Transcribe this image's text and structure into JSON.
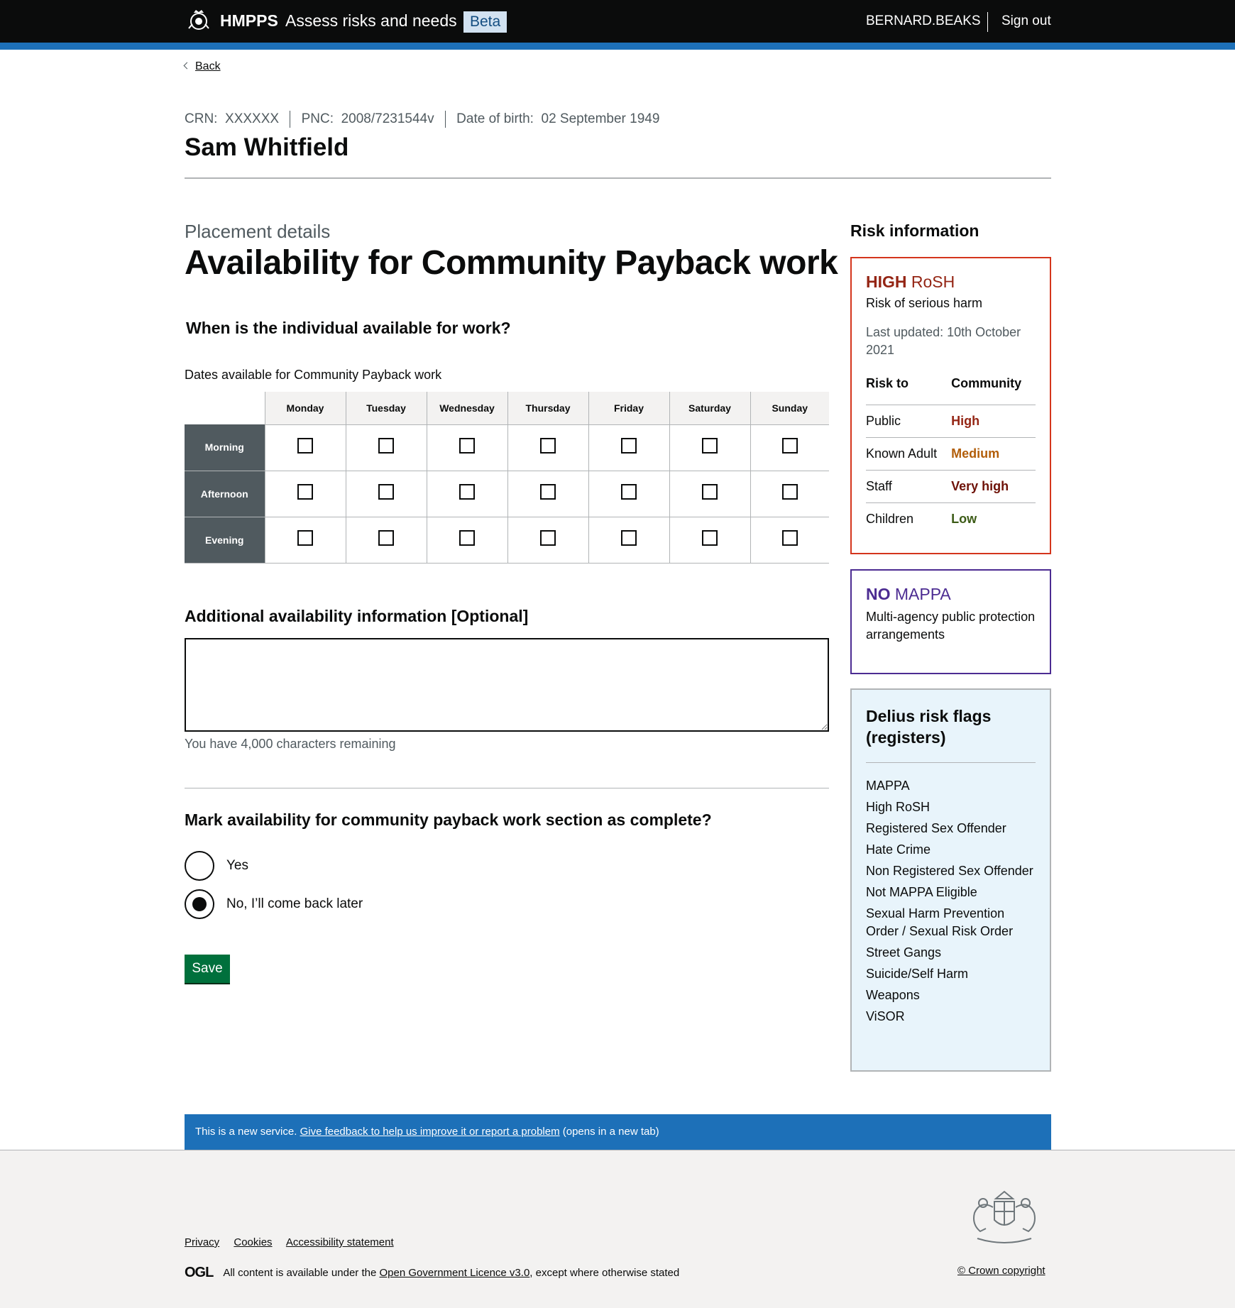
{
  "header": {
    "brand": "HMPPS",
    "service": "Assess risks and needs",
    "tag": "Beta",
    "username": "BERNARD.BEAKS",
    "signout": "Sign out"
  },
  "back": "Back",
  "person": {
    "crn_label": "CRN:",
    "crn": "XXXXXX",
    "pnc_label": "PNC:",
    "pnc": "2008/7231544v",
    "dob_label": "Date of birth:",
    "dob": "02 September 1949",
    "name": "Sam Whitfield"
  },
  "main": {
    "caption": "Placement details",
    "title": "Availability for Community Payback work",
    "question": "When is the individual available for work?",
    "table_caption": "Dates available for Community Payback work",
    "days": [
      "Monday",
      "Tuesday",
      "Wednesday",
      "Thursday",
      "Friday",
      "Saturday",
      "Sunday"
    ],
    "periods": [
      "Morning",
      "Afternoon",
      "Evening"
    ],
    "additional_label": "Additional availability information [Optional]",
    "additional_value": "",
    "char_count": "You have 4,000 characters remaining",
    "complete_question": "Mark availability for community payback work section as complete?",
    "radio_yes": "Yes",
    "radio_no": "No, I’ll come back later",
    "save": "Save"
  },
  "sidebar": {
    "heading": "Risk information",
    "rosh": {
      "level": "HIGH",
      "level_suffix": "RoSH",
      "subtitle": "Risk of serious harm",
      "updated": "Last updated: 10th October 2021",
      "col_risk_to": "Risk to",
      "col_community": "Community",
      "rows": [
        {
          "label": "Public",
          "value": "High",
          "color": "#942514"
        },
        {
          "label": "Known Adult",
          "value": "Medium",
          "color": "#b25e0a"
        },
        {
          "label": "Staff",
          "value": "Very high",
          "color": "#6e1208"
        },
        {
          "label": "Children",
          "value": "Low",
          "color": "#3c5b16"
        }
      ]
    },
    "mappa": {
      "level": "NO",
      "level_suffix": "MAPPA",
      "subtitle": "Multi-agency public protection arrangements"
    },
    "flags": {
      "title": "Delius risk flags (registers)",
      "items": [
        "MAPPA",
        "High RoSH",
        "Registered Sex Offender",
        "Hate Crime",
        "Non Registered Sex Offender",
        "Not MAPPA Eligible",
        "Sexual Harm Prevention Order / Sexual Risk Order",
        "Street Gangs",
        "Suicide/Self Harm",
        "Weapons",
        "ViSOR"
      ]
    }
  },
  "feedback": {
    "prefix": "This is a new service.",
    "link": "Give feedback to help us improve it or report a problem",
    "suffix": "(opens in a new tab)"
  },
  "footer": {
    "links": [
      "Privacy",
      "Cookies",
      "Accessibility statement"
    ],
    "ogl_logo": "OGL",
    "ogl_prefix": "All content is available under the",
    "ogl_link": "Open Government Licence v3.0",
    "ogl_suffix": ", except where otherwise stated",
    "copyright": "© Crown copyright"
  },
  "colors": {
    "header_bg": "#0b0c0c",
    "accent_blue": "#1d70b8",
    "save_green": "#00703c",
    "rosh_red": "#d4351c",
    "mappa_purple": "#4c2c92",
    "flags_bg": "#e8f4fb"
  },
  "icons": {
    "header_crest": "royal-crest-icon",
    "footer_crest": "royal-coat-of-arms-icon"
  }
}
